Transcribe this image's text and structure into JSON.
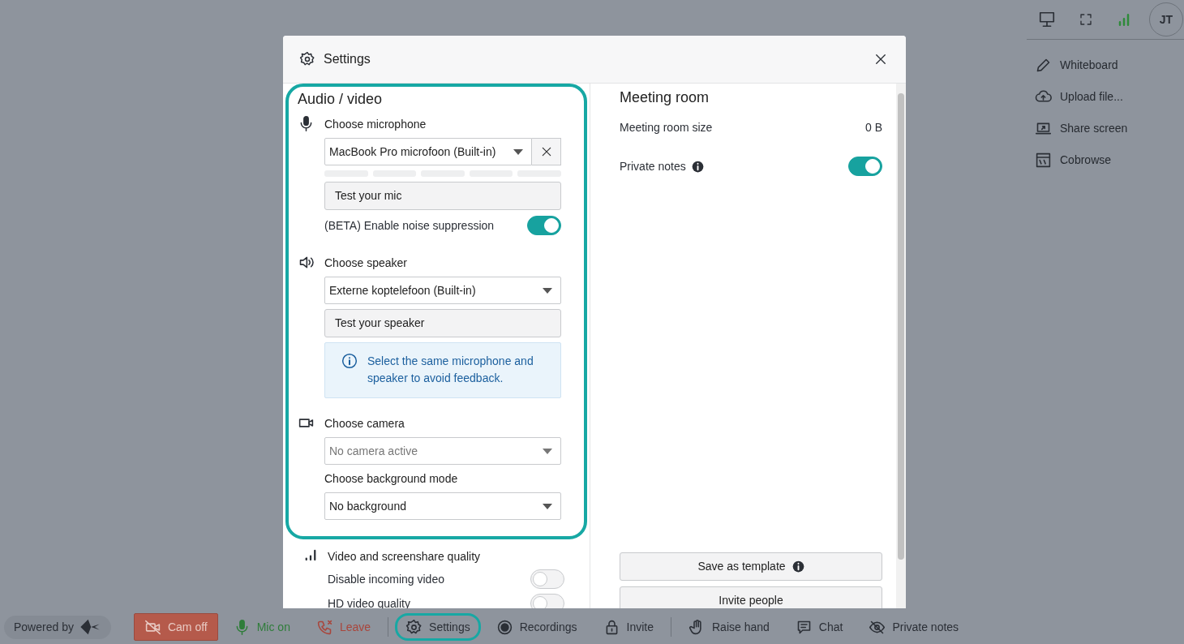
{
  "top_bar": {
    "avatar": "JT"
  },
  "side_menu": [
    {
      "label": "Whiteboard"
    },
    {
      "label": "Upload file..."
    },
    {
      "label": "Share screen"
    },
    {
      "label": "Cobrowse"
    }
  ],
  "toolbar": {
    "powered_by": "Powered by",
    "groups": [
      {
        "items": [
          {
            "label": "Cam off",
            "kind": "filled",
            "color": "#b55a4b",
            "highlighted": false
          },
          {
            "label": "Mic on",
            "kind": "plain",
            "color": "#2f7d3a",
            "highlighted": false
          },
          {
            "label": "Leave",
            "kind": "plain",
            "color": "#a9463c",
            "highlighted": false
          }
        ]
      },
      {
        "items": [
          {
            "label": "Settings",
            "kind": "plain",
            "color": "#2b2f36",
            "highlighted": true
          },
          {
            "label": "Recordings",
            "kind": "plain",
            "color": "#2b2f36",
            "highlighted": false
          },
          {
            "label": "Invite",
            "kind": "plain",
            "color": "#2b2f36",
            "highlighted": false
          }
        ]
      },
      {
        "items": [
          {
            "label": "Raise hand",
            "kind": "plain",
            "color": "#2b2f36",
            "highlighted": false
          },
          {
            "label": "Chat",
            "kind": "plain",
            "color": "#2b2f36",
            "highlighted": false
          },
          {
            "label": "Private notes",
            "kind": "plain",
            "color": "#2b2f36",
            "highlighted": false
          }
        ]
      }
    ]
  },
  "settings": {
    "title": "Settings",
    "audio_video": {
      "heading": "Audio / video",
      "highlighted": true,
      "microphone": {
        "label": "Choose microphone",
        "value": "MacBook Pro microfoon (Built-in)",
        "test_button": "Test your mic",
        "noise_suppression": {
          "label": "(BETA) Enable noise suppression",
          "on": true
        }
      },
      "speaker": {
        "label": "Choose speaker",
        "value": "Externe koptelefoon (Built-in)",
        "test_button": "Test your speaker",
        "info": "Select the same microphone and speaker to avoid feedback."
      },
      "camera": {
        "label": "Choose camera",
        "placeholder": "No camera active"
      },
      "background": {
        "label": "Choose background mode",
        "value": "No background"
      }
    },
    "quality": {
      "heading": "Video and screenshare quality",
      "toggles": [
        {
          "label": "Disable incoming video",
          "on": false
        },
        {
          "label": "HD video quality",
          "on": false
        }
      ]
    },
    "meeting_room": {
      "heading": "Meeting room",
      "size_label": "Meeting room size",
      "size_value": "0 B",
      "private_notes": {
        "label": "Private notes",
        "on": true
      }
    },
    "buttons": [
      "Save as template",
      "Invite people"
    ]
  }
}
